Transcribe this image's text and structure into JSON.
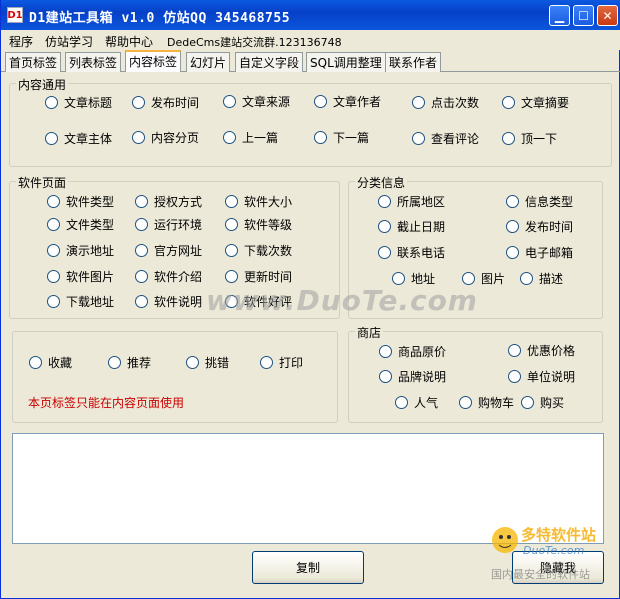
{
  "window": {
    "title": "D1建站工具箱 v1.0   仿站QQ 345468755",
    "app_icon": "D1"
  },
  "menu": [
    "程序",
    "仿站学习",
    "帮助中心",
    "DedeCms建站交流群.123136748"
  ],
  "tabs": [
    "首页标签",
    "列表标签",
    "内容标签",
    "幻灯片",
    "自定义字段",
    "SQL调用整理",
    "联系作者"
  ],
  "content_general": {
    "title": "内容通用",
    "row1": [
      "文章标题",
      "发布时间",
      "文章来源",
      "文章作者",
      "点击次数",
      "文章摘要"
    ],
    "row2": [
      "文章主体",
      "内容分页",
      "上一篇",
      "下一篇",
      "查看评论",
      "顶一下"
    ]
  },
  "software": {
    "title": "软件页面",
    "rows": [
      [
        "软件类型",
        "授权方式",
        "软件大小"
      ],
      [
        "文件类型",
        "运行环境",
        "软件等级"
      ],
      [
        "演示地址",
        "官方网址",
        "下载次数"
      ],
      [
        "软件图片",
        "软件介绍",
        "更新时间"
      ],
      [
        "下载地址",
        "软件说明",
        "软件好评"
      ]
    ]
  },
  "category": {
    "title": "分类信息",
    "rows": [
      [
        "所属地区",
        "信息类型"
      ],
      [
        "截止日期",
        "发布时间"
      ],
      [
        "联系电话",
        "电子邮箱"
      ]
    ],
    "row4": [
      "地址",
      "图片",
      "描述"
    ]
  },
  "misc": {
    "items": [
      "收藏",
      "推荐",
      "挑错",
      "打印"
    ],
    "note": "本页标签只能在内容页面使用"
  },
  "shop": {
    "title": "商店",
    "rows": [
      [
        "商品原价",
        "优惠价格"
      ],
      [
        "品牌说明",
        "单位说明"
      ]
    ],
    "row3": [
      "人气",
      "购物车",
      "购买"
    ]
  },
  "buttons": {
    "copy": "复制",
    "hide": "隐藏我"
  },
  "watermark": {
    "text": "www.DuoTe.com",
    "logo_brand": "多特软件站",
    "logo_sub": "国内最安全的软件站",
    "logo_url": "DuoTe.com"
  }
}
